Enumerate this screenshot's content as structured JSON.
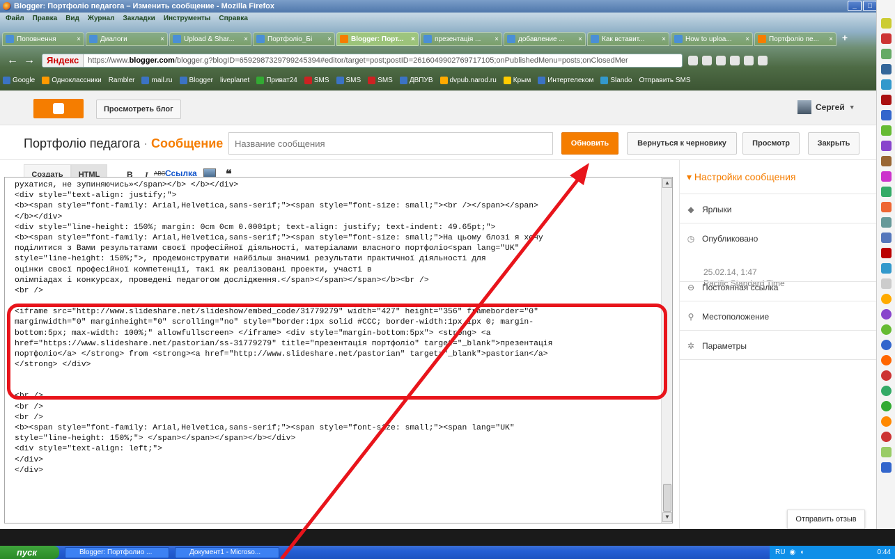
{
  "window": {
    "title": "Blogger: Портфоліо педагога – Изменить сообщение - Mozilla Firefox"
  },
  "menu": [
    "Файл",
    "Правка",
    "Вид",
    "Журнал",
    "Закладки",
    "Инструменты",
    "Справка"
  ],
  "tabs": [
    {
      "label": "Поповнення",
      "active": false
    },
    {
      "label": "Диалоги",
      "active": false
    },
    {
      "label": "Upload & Shar...",
      "active": false
    },
    {
      "label": "Портфоліо_Бі",
      "active": false
    },
    {
      "label": "Blogger: Порт...",
      "active": true
    },
    {
      "label": "презентація ...",
      "active": false
    },
    {
      "label": "добавление ...",
      "active": false
    },
    {
      "label": "Как вставит...",
      "active": false
    },
    {
      "label": "How to uploa...",
      "active": false
    },
    {
      "label": "Портфоліо пе...",
      "active": false
    }
  ],
  "address": {
    "search_engine": "Яндекс",
    "url_prefix": "https://www.",
    "url_domain": "blogger.com",
    "url_rest": "/blogger.g?blogID=6592987329799245394#editor/target=post;postID=2616049902769717105;onPublishedMenu=posts;onClosedMer"
  },
  "bookmarks": [
    "Google",
    "Одноклассники",
    "Rambler",
    "mail.ru",
    "Blogger",
    "liveplanet",
    "Приват24",
    "SMS",
    "SMS",
    "SMS",
    "ДВПУВ",
    "dvpub.narod.ru",
    "Крым",
    "Интертелеком",
    "Slando",
    "Отправить SMS"
  ],
  "blogger": {
    "view_blog": "Просмотреть блог",
    "user_name": "Сергей",
    "blog_name": "Портфоліо педагога",
    "separator": "·",
    "section": "Сообщение",
    "title_placeholder": "Название сообщения",
    "update": "Обновить",
    "revert_draft": "Вернуться к черновику",
    "preview": "Просмотр",
    "close": "Закрыть"
  },
  "editor": {
    "compose_tab": "Создать",
    "html_tab": "HTML",
    "bold": "B",
    "italic": "I",
    "strike": "ABC",
    "link": "Ссылка",
    "quote": "❝",
    "code_lines_top": [
      "рухатися, не зупиняючись»</span></b> </b></div>",
      "<div style=\"text-align: justify;\">",
      "<b><span style=\"font-family: Arial,Helvetica,sans-serif;\"><span style=\"font-size: small;\"><br /></span></span>",
      "</b></div>",
      "<div style=\"line-height: 150%; margin: 0cm 0cm 0.0001pt; text-align: justify; text-indent: 49.65pt;\">",
      "<b><span style=\"font-family: Arial,Helvetica,sans-serif;\"><span style=\"font-size: small;\">На цьому блозі я хочу",
      "поділитися з Вами результатами своєї професійної діяльності, матеріалами власного портфоліо<span lang=\"UK\"",
      "style=\"line-height: 150%;\">, продемонструвати найбільш значимі результати практичної діяльності для",
      "оцінки своєї професійної компетенції, такі як реалізовані проекти, участі в",
      "олімпіадах і конкурсах, проведені педагогом дослідження.</span></span></span></b><br />",
      "<br />"
    ],
    "code_lines_iframe": [
      "<iframe src=\"http://www.slideshare.net/slideshow/embed_code/31779279\" width=\"427\" height=\"356\" frameborder=\"0\"",
      "marginwidth=\"0\" marginheight=\"0\" scrolling=\"no\" style=\"border:1px solid #CCC; border-width:1px 1px 0; margin-",
      "bottom:5px; max-width: 100%;\" allowfullscreen> </iframe> <div style=\"margin-bottom:5px\"> <strong> <a",
      "href=\"https://www.slideshare.net/pastorian/ss-31779279\" title=\"презентація портфоліо\" target=\"_blank\">презентація",
      "портфоліо</a> </strong> from <strong><a href=\"http://www.slideshare.net/pastorian\" target=\"_blank\">pastorian</a>",
      "</strong> </div>"
    ],
    "code_lines_bottom": [
      "<br />",
      "<br />",
      "<br />",
      "<b><span style=\"font-family: Arial,Helvetica,sans-serif;\"><span style=\"font-size: small;\"><span lang=\"UK\"",
      "style=\"line-height: 150%;\"> </span></span></span></b></div>",
      "<div style=\"text-align: left;\">",
      "</div>",
      "</div>"
    ]
  },
  "settings": {
    "heading": "Настройки сообщения",
    "labels": "Ярлыки",
    "published": "Опубликовано",
    "published_date": "25.02.14, 1:47",
    "published_tz": "Pacific Standard Time",
    "permalink": "Постоянная ссылка",
    "location": "Местоположение",
    "options": "Параметры"
  },
  "feedback": "Отправить отзыв",
  "taskbar": {
    "start": "пуск",
    "tasks": [
      "Blogger: Портфолио ...",
      "Документ1 - Microso..."
    ],
    "lang": "RU",
    "clock": "0:44"
  },
  "colors": {
    "blogger_orange": "#f57d00",
    "highlight_red": "#e8141b"
  }
}
